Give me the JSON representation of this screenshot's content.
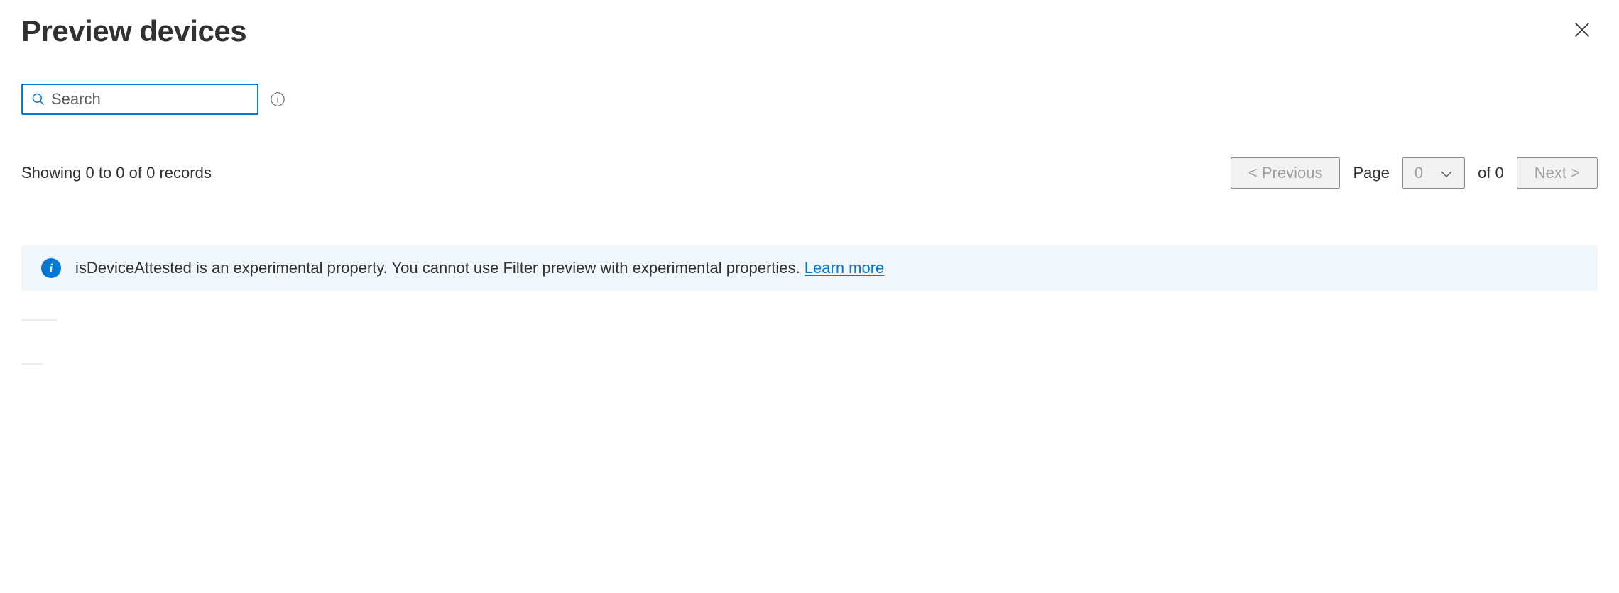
{
  "header": {
    "title": "Preview devices"
  },
  "search": {
    "placeholder": "Search",
    "value": ""
  },
  "records": {
    "text": "Showing 0 to 0 of 0 records"
  },
  "pagination": {
    "previous_label": "<  Previous",
    "page_label": "Page",
    "page_value": "0",
    "of_label": "of 0",
    "next_label": "Next  >"
  },
  "banner": {
    "message": "isDeviceAttested is an experimental property. You cannot use Filter preview with experimental properties. ",
    "link_text": "Learn more"
  }
}
